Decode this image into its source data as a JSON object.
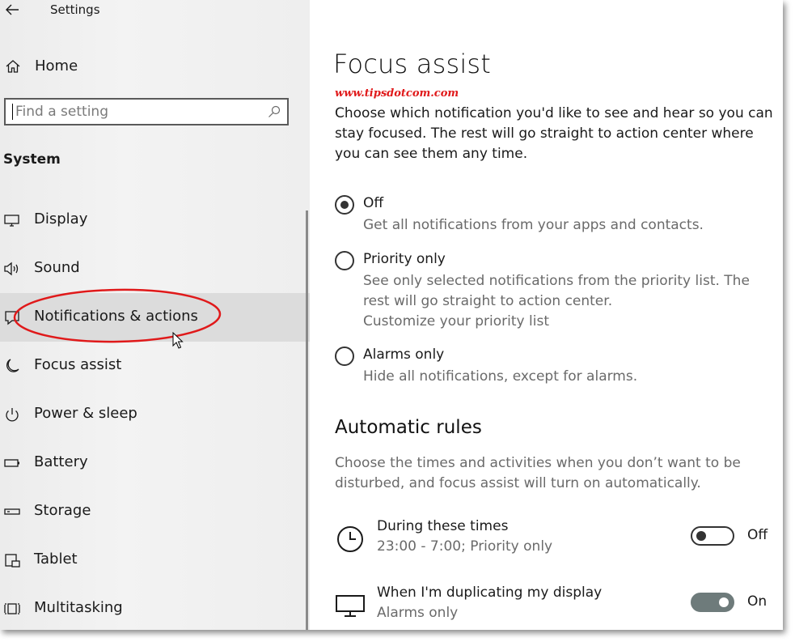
{
  "window": {
    "title": "Settings"
  },
  "sidebar": {
    "home_label": "Home",
    "search": {
      "placeholder": "Find a setting",
      "value": ""
    },
    "section": "System",
    "items": [
      {
        "label": "Display",
        "icon": "display-icon"
      },
      {
        "label": "Sound",
        "icon": "speaker-icon"
      },
      {
        "label": "Notifications & actions",
        "icon": "message-icon",
        "selected": true,
        "annotated": "red-ellipse"
      },
      {
        "label": "Focus assist",
        "icon": "moon-icon"
      },
      {
        "label": "Power & sleep",
        "icon": "power-icon"
      },
      {
        "label": "Battery",
        "icon": "battery-icon"
      },
      {
        "label": "Storage",
        "icon": "storage-icon"
      },
      {
        "label": "Tablet",
        "icon": "tablet-icon"
      },
      {
        "label": "Multitasking",
        "icon": "multitasking-icon"
      }
    ]
  },
  "main": {
    "title": "Focus assist",
    "watermark": "www.tipsdotcom.com",
    "description": "Choose which notification you'd like to see and hear so you can stay focused. The rest will go straight to action center where you can see them any time.",
    "options": [
      {
        "label": "Off",
        "description": "Get all notifications from your apps and contacts.",
        "checked": true
      },
      {
        "label": "Priority only",
        "description": "See only selected notifications from the priority list. The rest will go straight to action center.",
        "link": "Customize your priority list",
        "checked": false
      },
      {
        "label": "Alarms only",
        "description": "Hide all notifications, except for alarms.",
        "checked": false
      }
    ],
    "rules_heading": "Automatic rules",
    "rules_description": "Choose the times and activities when you don’t want to be disturbed, and focus assist will turn on automatically.",
    "rules": [
      {
        "title": "During these times",
        "subtitle": "23:00 - 7:00; Priority only",
        "state": "Off",
        "on": false,
        "icon": "clock-icon"
      },
      {
        "title": "When I'm duplicating my display",
        "subtitle": "Alarms only",
        "state": "On",
        "on": true,
        "icon": "monitor-icon"
      }
    ]
  },
  "colors": {
    "accent_red": "#e0191a",
    "toggle_on": "#6e7b7b",
    "sidebar_selected": "#dcdcdc"
  }
}
